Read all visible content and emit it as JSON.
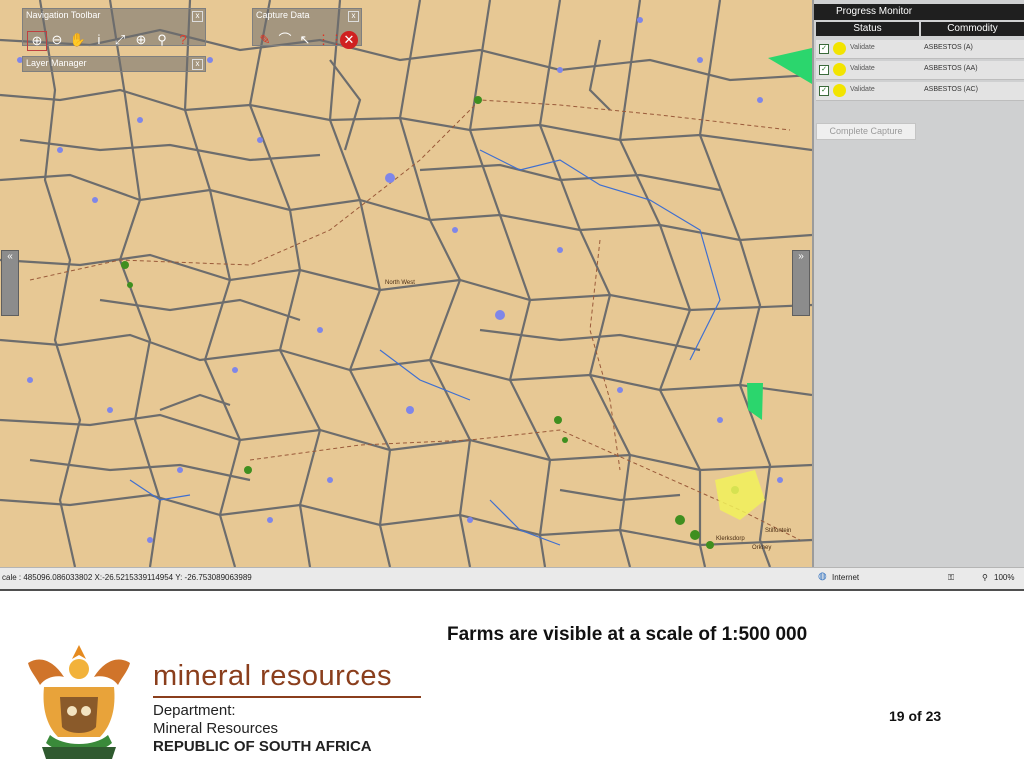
{
  "app": {
    "panels": {
      "navigation": {
        "title": "Navigation Toolbar",
        "close": "x"
      },
      "capture": {
        "title": "Capture Data",
        "close": "x"
      },
      "layers": {
        "title": "Layer Manager",
        "close": "x"
      }
    },
    "tool_icons": {
      "navigation": [
        "zoom-in-box-icon",
        "zoom-out-icon",
        "pan-hand-icon",
        "info-icon",
        "full-extent-icon",
        "zoom-in-icon",
        "search-icon",
        "help-icon"
      ],
      "capture": [
        "pencil-icon",
        "draw-line-icon",
        "select-arrow-icon",
        "grid-icon",
        "delete-icon"
      ]
    },
    "side_arrows": {
      "left": "«",
      "right": "»"
    },
    "map": {
      "labels": [
        {
          "text": "North West"
        },
        {
          "text": "Stilfontein"
        },
        {
          "text": "Orkney"
        },
        {
          "text": "Klerksdorp"
        }
      ],
      "colors": {
        "land": "#e7c894",
        "boundary": "#6d6d6d",
        "water": "#7f86e8",
        "river": "#3f6fd0",
        "settlement": "#3f8f1f",
        "polygon": "#2bd66d"
      }
    },
    "progress_monitor": {
      "title": "Progress Monitor",
      "columns": [
        "Status",
        "Commodity"
      ],
      "rows": [
        {
          "status": "Validate",
          "commodity": "ASBESTOS (A)",
          "checked": true
        },
        {
          "status": "Validate",
          "commodity": "ASBESTOS (AA)",
          "checked": true
        },
        {
          "status": "Validate",
          "commodity": "ASBESTOS (AC)",
          "checked": true
        }
      ],
      "complete_button": "Complete Capture"
    },
    "statusbar": {
      "scale_text": "cale : 485096.086033802  X:-26.5215339114954  Y: -26.753089063989",
      "zone": "Internet",
      "zoom": "100%"
    }
  },
  "slide": {
    "caption": "Farms are visible at a scale of 1:500 000",
    "page_number": "19 of 23",
    "brand": {
      "name": "mineral resources",
      "department": "Department:",
      "department_name": "Mineral Resources",
      "country": "REPUBLIC OF SOUTH AFRICA"
    }
  }
}
